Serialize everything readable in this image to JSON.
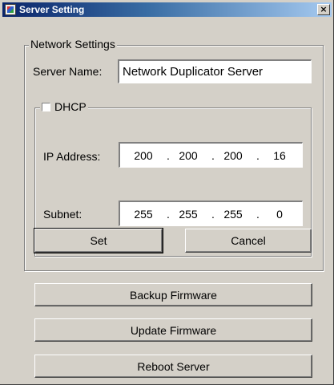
{
  "window": {
    "title": "Server Setting",
    "close_glyph": "×",
    "app_icon": "app-icon"
  },
  "network_settings": {
    "legend": "Network Settings",
    "server_name_label": "Server Name:",
    "server_name_value": "Network Duplicator Server",
    "dhcp": {
      "label": "DHCP",
      "checked": false,
      "ip_label": "IP Address:",
      "ip_octets": [
        "200",
        "200",
        "200",
        "16"
      ],
      "subnet_label": "Subnet:",
      "subnet_octets": [
        "255",
        "255",
        "255",
        "0"
      ]
    },
    "set_label": "Set",
    "cancel_label": "Cancel"
  },
  "actions": {
    "backup_label": "Backup Firmware",
    "update_label": "Update Firmware",
    "reboot_label": "Reboot Server"
  },
  "colors": {
    "dialog_bg": "#d4d0c8",
    "title_gradient_start": "#0a246a",
    "title_gradient_end": "#a6caf0"
  }
}
